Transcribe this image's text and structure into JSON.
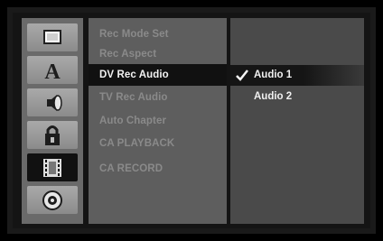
{
  "menu": {
    "items": [
      {
        "label": "Rec Mode Set",
        "selected": false
      },
      {
        "label": "Rec Aspect",
        "selected": false
      },
      {
        "label": "DV Rec Audio",
        "selected": true
      },
      {
        "label": "TV Rec Audio",
        "selected": false
      },
      {
        "label": "Auto Chapter",
        "selected": false
      },
      {
        "label": "CA PLAYBACK",
        "selected": false
      },
      {
        "label": "CA RECORD",
        "selected": false
      }
    ]
  },
  "options": {
    "items": [
      {
        "label": "Audio 1",
        "selected": true
      },
      {
        "label": "Audio 2",
        "selected": false
      }
    ],
    "check_icon": "checkmark-icon"
  },
  "sidebar": {
    "icons": [
      {
        "name": "display-icon",
        "selected": false
      },
      {
        "name": "language-icon",
        "selected": false
      },
      {
        "name": "speaker-icon",
        "selected": false
      },
      {
        "name": "lock-icon",
        "selected": false
      },
      {
        "name": "film-record-icon",
        "selected": true
      },
      {
        "name": "disc-icon",
        "selected": false
      }
    ]
  }
}
